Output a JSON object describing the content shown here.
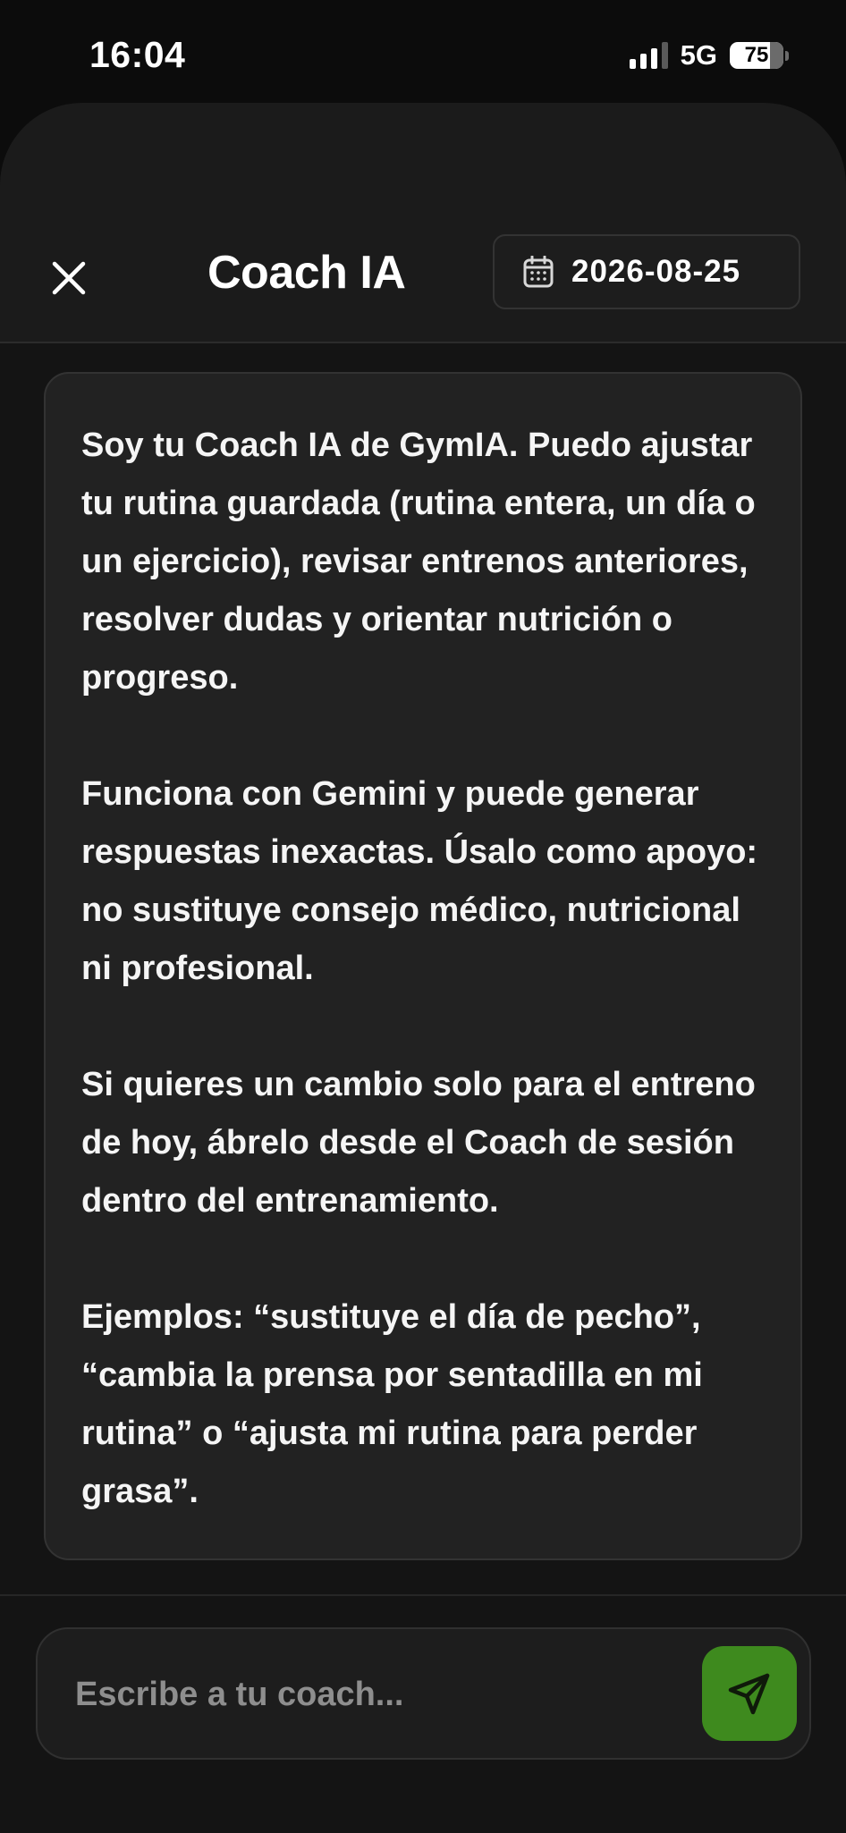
{
  "status_bar": {
    "time": "16:04",
    "network": "5G",
    "battery": "75"
  },
  "header": {
    "title": "Coach IA",
    "date": "2026-08-25",
    "close_icon": "close-icon",
    "calendar_icon": "calendar-icon"
  },
  "message": {
    "paragraphs": [
      "Soy tu Coach IA de GymIA. Puedo ajustar tu rutina guardada (rutina entera, un día o un ejercicio), revisar entrenos anteriores, resolver dudas y orientar nutrición o progreso.",
      "Funciona con Gemini y puede generar respuestas inexactas. Úsalo como apoyo: no sustituye consejo médico, nutricional ni profesional.",
      "Si quieres un cambio solo para el entreno de hoy, ábrelo desde el Coach de sesión dentro del entrenamiento.",
      "Ejemplos: “sustituye el día de pecho”, “cambia la prensa por sentadilla en mi rutina” o “ajusta mi rutina para perder grasa”."
    ]
  },
  "composer": {
    "placeholder": "Escribe a tu coach...",
    "value": "",
    "send_icon": "send-icon"
  },
  "colors": {
    "accent": "#3e8a1e",
    "background": "#0c0c0c",
    "card": "#222222"
  }
}
